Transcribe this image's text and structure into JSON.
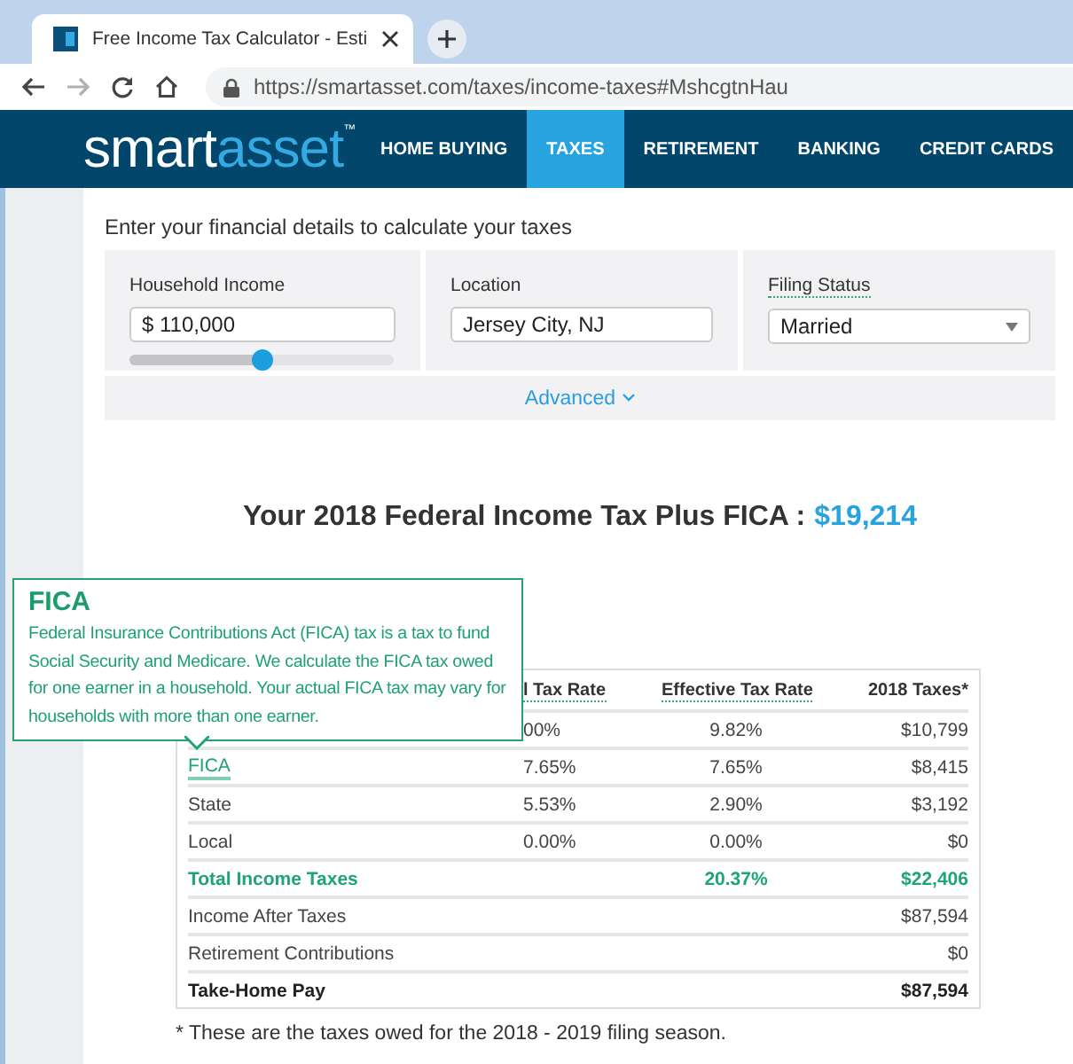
{
  "browser": {
    "tab_title": "Free Income Tax Calculator - Esti",
    "url": "https://smartasset.com/taxes/income-taxes#MshcgtnHau",
    "nav_buttons": [
      {
        "kind": "back",
        "disabled": false
      },
      {
        "kind": "forward",
        "disabled": true
      },
      {
        "kind": "reload",
        "disabled": false
      },
      {
        "kind": "home",
        "disabled": false
      }
    ]
  },
  "site_nav": {
    "logo": {
      "first": "smart",
      "second": "asset",
      "mark": "™"
    },
    "items": [
      {
        "label": "HOME BUYING",
        "selected": false
      },
      {
        "label": "TAXES",
        "selected": true
      },
      {
        "label": "RETIREMENT",
        "selected": false
      },
      {
        "label": "BANKING",
        "selected": false
      },
      {
        "label": "CREDIT CARDS",
        "selected": false
      }
    ]
  },
  "form": {
    "intro": "Enter your financial details to calculate your taxes",
    "household_income": {
      "label": "Household Income",
      "value": "$ 110,000",
      "level": 0.5
    },
    "location": {
      "label": "Location",
      "value": "Jersey City, NJ"
    },
    "filing_status": {
      "label": "Filing Status",
      "value": "Married"
    },
    "advanced": "Advanced"
  },
  "result": {
    "heading": "Your 2018 Federal Income Tax Plus FICA :",
    "amount": "$19,214"
  },
  "table": {
    "columns": [
      {
        "label": "l Tax Rate"
      },
      {
        "label": "Effective Tax Rate"
      },
      {
        "label": "2018 Taxes*"
      }
    ],
    "rows": [
      {
        "kind": "plain",
        "marginal": "00%",
        "effective": "9.82%",
        "taxes": "$10,799"
      },
      {
        "kind": "link",
        "label": "FICA",
        "marginal": "7.65%",
        "effective": "7.65%",
        "taxes": "$8,415"
      },
      {
        "kind": "plain",
        "label": "State",
        "marginal": "5.53%",
        "effective": "2.90%",
        "taxes": "$3,192"
      },
      {
        "kind": "plain",
        "label": "Local",
        "marginal": "0.00%",
        "effective": "0.00%",
        "taxes": "$0"
      },
      {
        "kind": "total",
        "label": "Total Income Taxes",
        "effective": "20.37%",
        "taxes": "$22,406"
      },
      {
        "kind": "plain",
        "label": "Income After Taxes",
        "taxes": "$87,594"
      },
      {
        "kind": "plain",
        "label": "Retirement Contributions",
        "taxes": "$0"
      },
      {
        "kind": "strong",
        "label": "Take-Home Pay",
        "taxes": "$87,594"
      }
    ]
  },
  "footnote": "* These are the taxes owed for the 2018 - 2019 filing season.",
  "tooltip": {
    "title": "FICA",
    "body": "Federal Insurance Contributions Act (FICA) tax is a tax to fund Social Security and Medicare. We calculate the FICA tax owed for one earner in a household. Your actual FICA tax may vary for households with more than one earner."
  }
}
